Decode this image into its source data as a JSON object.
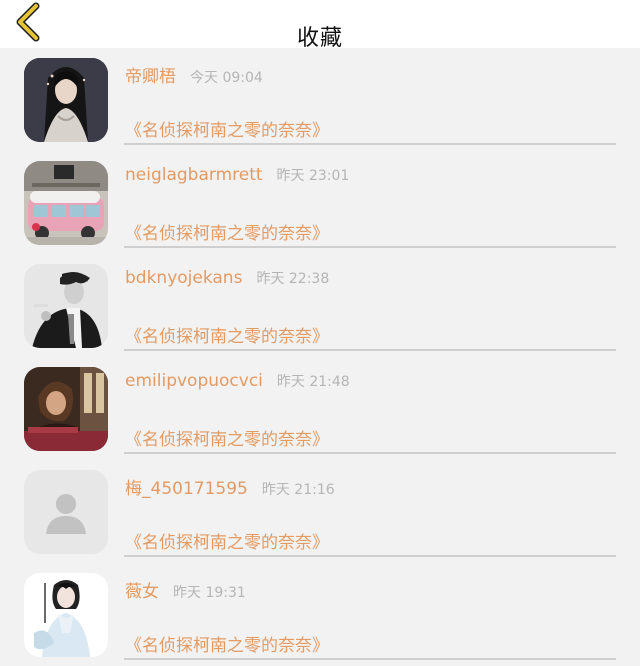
{
  "header": {
    "title": "收藏",
    "back_icon": "chevron-left-icon",
    "accent_color": "#e6c437"
  },
  "favorites": [
    {
      "username": "帝卿梧",
      "time": "今天 09:04",
      "content": "《名侦探柯南之零的奈奈》",
      "avatar": "girl-portrait-dark"
    },
    {
      "username": "neiglagbarmrett",
      "time": "昨天 23:01",
      "content": "《名侦探柯南之零的奈奈》",
      "avatar": "pink-bus-toy"
    },
    {
      "username": "bdknyojekans",
      "time": "昨天 22:38",
      "content": "《名侦探柯南之零的奈奈》",
      "avatar": "man-black-white"
    },
    {
      "username": "emilipvopuocvci",
      "time": "昨天 21:48",
      "content": "《名侦探柯南之零的奈奈》",
      "avatar": "woman-sepia"
    },
    {
      "username": "梅_450171595",
      "time": "昨天 21:16",
      "content": "《名侦探柯南之零的奈奈》",
      "avatar": "default-person-icon"
    },
    {
      "username": "薇女",
      "time": "昨天 19:31",
      "content": "《名侦探柯南之零的奈奈》",
      "avatar": "girl-illustration"
    }
  ],
  "colors": {
    "text_accent": "#e39a63",
    "time_gray": "#b5b5b5",
    "background": "#f2f2f2",
    "divider": "#cfcfcf"
  }
}
